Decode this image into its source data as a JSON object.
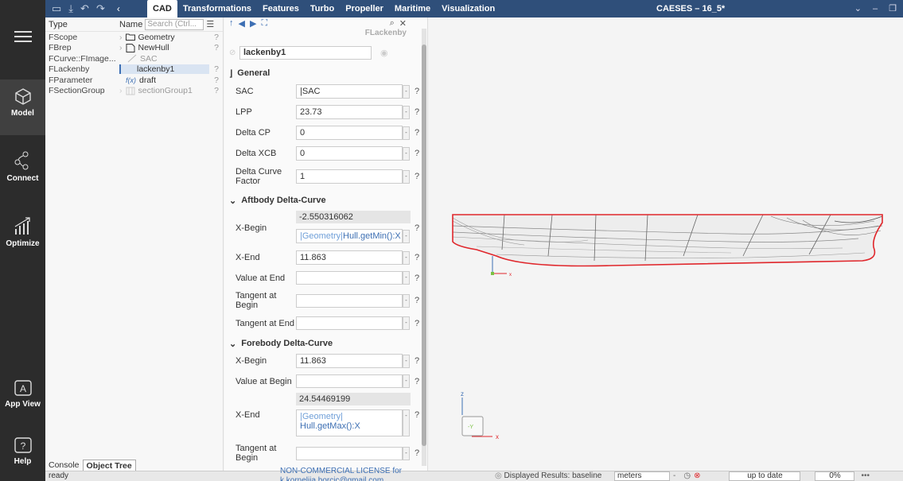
{
  "topbar": {
    "tabs": [
      "CAD",
      "Transformations",
      "Features",
      "Turbo",
      "Propeller",
      "Maritime",
      "Visualization"
    ],
    "active_tab": "CAD",
    "window_title": "CAESES – 16_5*"
  },
  "sidebar": {
    "items": [
      {
        "label": "",
        "icon": "menu-icon"
      },
      {
        "label": "Model",
        "icon": "cube-icon"
      },
      {
        "label": "Connect",
        "icon": "connect-icon"
      },
      {
        "label": "Optimize",
        "icon": "chart-bars-icon"
      },
      {
        "label": "App View",
        "icon": "app-view-icon"
      },
      {
        "label": "Help",
        "icon": "help-icon"
      }
    ]
  },
  "tree": {
    "col_type": "Type",
    "col_name": "Name",
    "search_placeholder": "Search (Ctrl...",
    "rows": [
      {
        "type": "FScope",
        "name": "Geometry",
        "icon": "folder-icon",
        "q": "?"
      },
      {
        "type": "FBrep",
        "name": "NewHull",
        "icon": "document-icon",
        "q": "?"
      },
      {
        "type": "FCurve::FImage...",
        "name": "SAC",
        "icon": "curve-icon",
        "q": ""
      },
      {
        "type": "FLackenby",
        "name": "lackenby1",
        "icon": "",
        "q": "?"
      },
      {
        "type": "FParameter",
        "name": "draft",
        "icon": "fx-icon",
        "q": "?"
      },
      {
        "type": "FSectionGroup",
        "name": "sectionGroup1",
        "icon": "section-icon",
        "q": "?"
      }
    ],
    "fx_label": "f(x)",
    "tabs": [
      "Console",
      "Object Tree"
    ],
    "active_tab": "Object Tree"
  },
  "props": {
    "object_type": "FLackenby",
    "object_name": "lackenby1",
    "general_title": "General",
    "sac_label": "SAC",
    "sac_value": "|SAC",
    "lpp_label": "LPP",
    "lpp_value": "23.73",
    "dcp_label": "Delta CP",
    "dcp_value": "0",
    "dxcb_label": "Delta XCB",
    "dxcb_value": "0",
    "dcf_label": "Delta Curve Factor",
    "dcf_value": "1",
    "aft_title": "Aftbody Delta-Curve",
    "aft_xbegin_label": "X-Begin",
    "aft_xbegin_computed": "-2.550316062",
    "aft_xbegin_expr_a": "|Geometry|",
    "aft_xbegin_expr_b": "Hull.getMin():X",
    "aft_xend_label": "X-End",
    "aft_xend_value": "11.863",
    "aft_vend_label": "Value at End",
    "aft_vend_value": "",
    "aft_tbegin_label": "Tangent at Begin",
    "aft_tbegin_value": "",
    "aft_tend_label": "Tangent at End",
    "aft_tend_value": "",
    "fore_title": "Forebody Delta-Curve",
    "fore_xbegin_label": "X-Begin",
    "fore_xbegin_value": "11.863",
    "fore_vbegin_label": "Value at Begin",
    "fore_vbegin_value": "",
    "fore_xend_label": "X-End",
    "fore_xend_computed": "24.54469199",
    "fore_xend_expr_a": "|Geometry|",
    "fore_xend_expr_b": "Hull.getMax():X",
    "fore_tbegin_label": "Tangent at Begin",
    "fore_tbegin_value": "",
    "help": "?"
  },
  "viewport": {
    "axis_z": "z",
    "axis_x": "x",
    "axis_y": "-Y",
    "outline_color": "#e0262b"
  },
  "status": {
    "ready": "ready",
    "license": "NON-COMMERCIAL LICENSE for k.kornelija.borcic@gmail.com",
    "displayed": "Displayed Results: baseline",
    "units": "meters",
    "up_to_date": "up to date",
    "percent": "0%",
    "more": "•••"
  }
}
